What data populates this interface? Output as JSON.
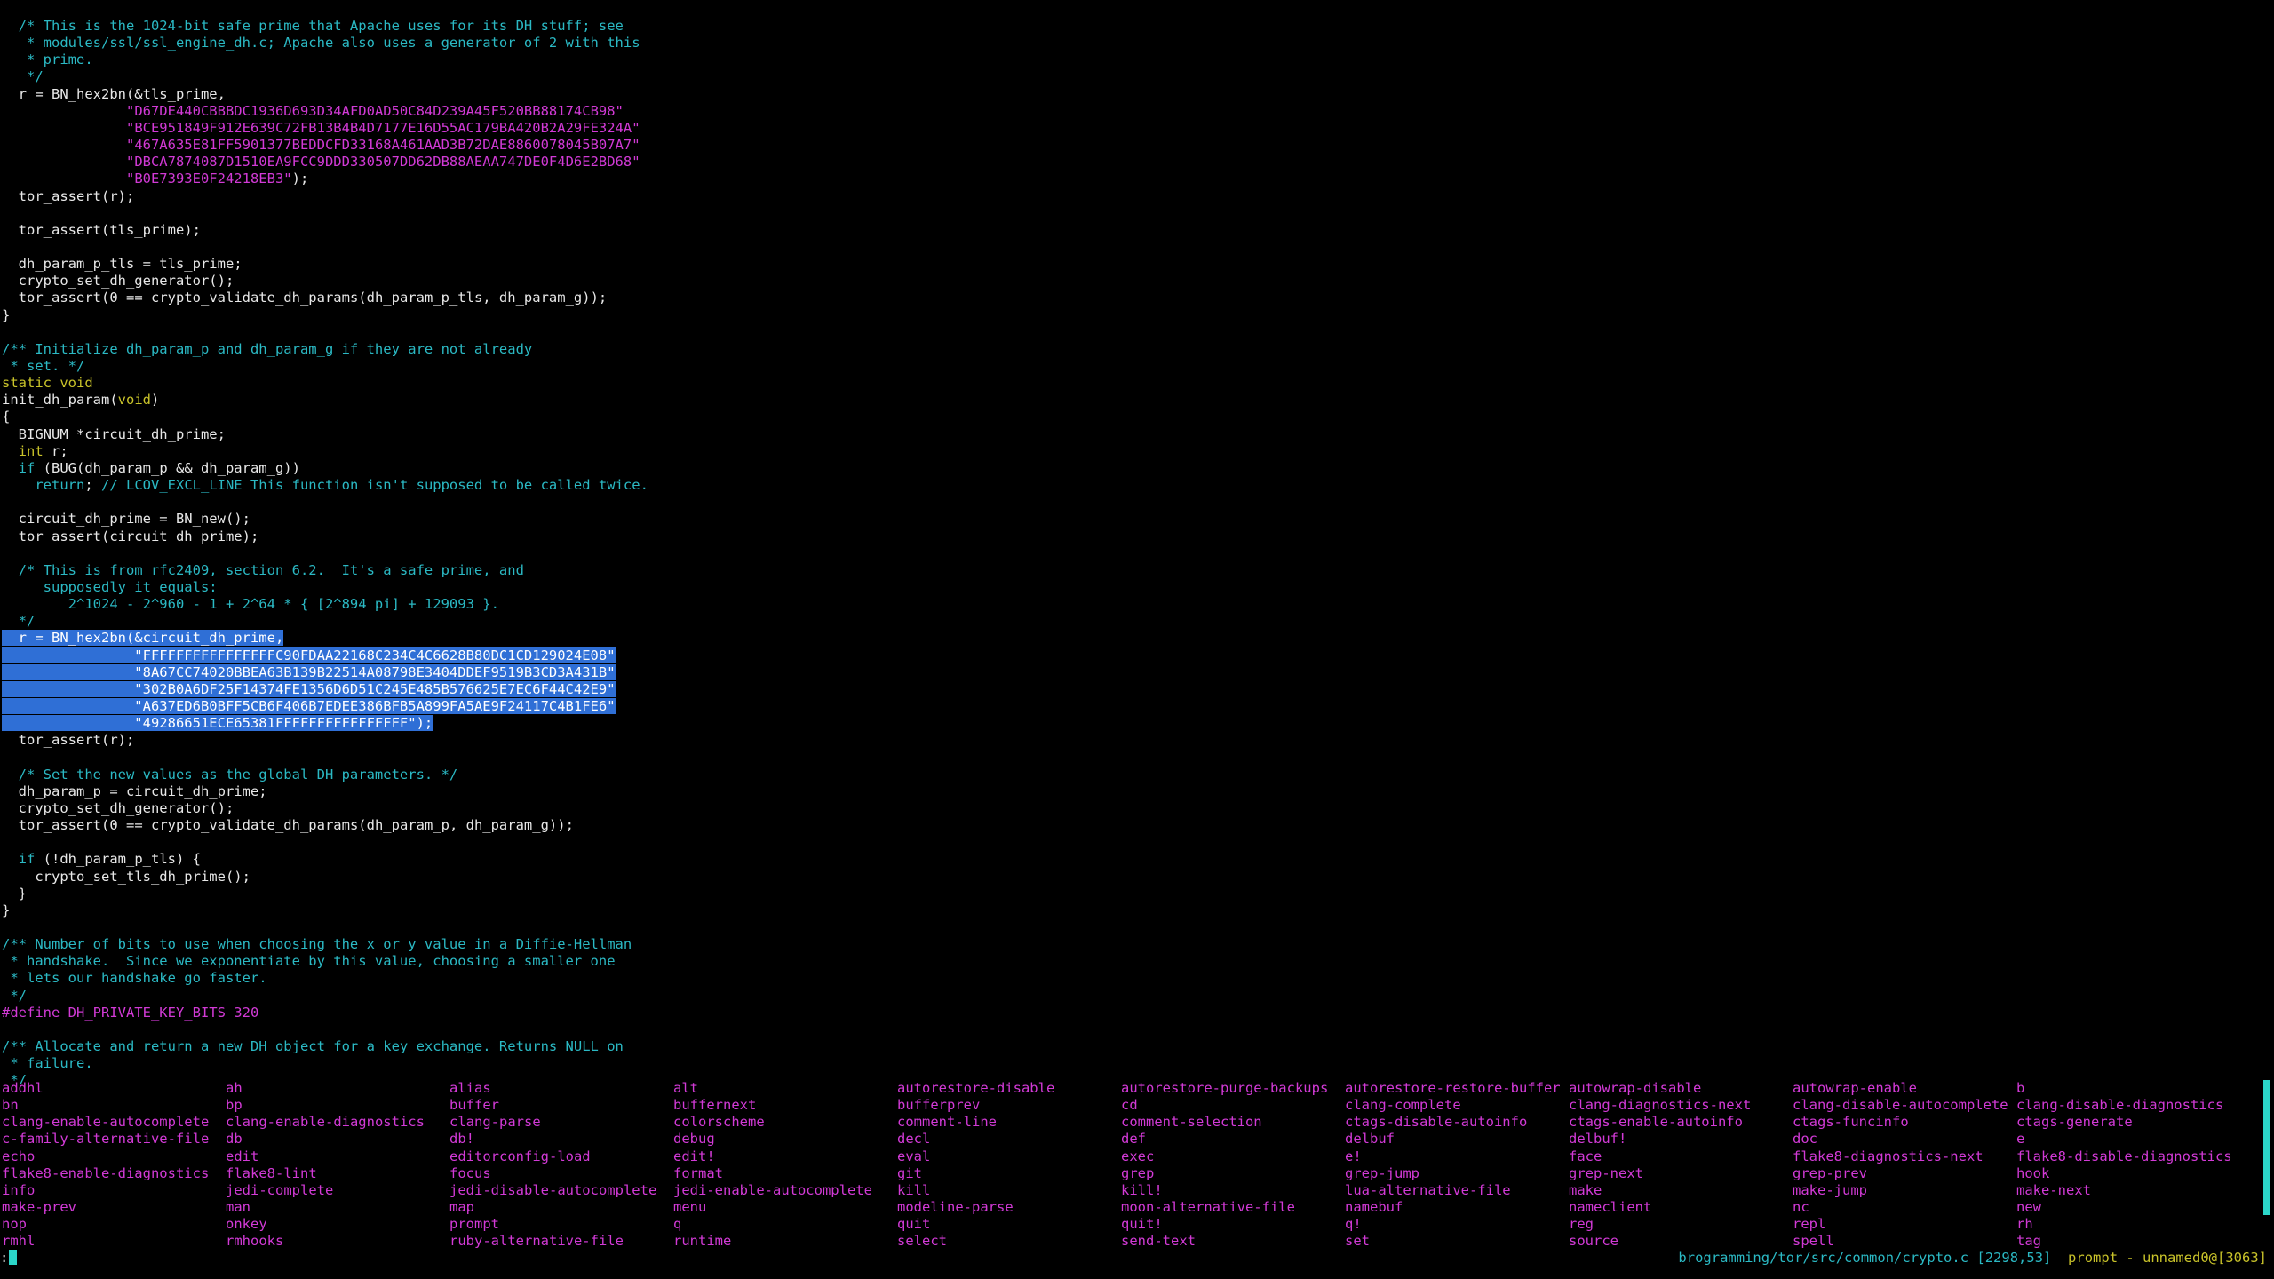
{
  "colors": {
    "background": "#000000",
    "comment": "#2bb9c4",
    "string": "#d23ad6",
    "type": "#c9c32a",
    "number": "#e01b1b",
    "selection": "#2f6fd6"
  },
  "code_lines": [
    [
      {
        "t": "  /* This is the 1024-bit safe prime that Apache uses for its DH stuff; see",
        "c": "comment"
      }
    ],
    [
      {
        "t": "   * modules/ssl/ssl_engine_dh.c; Apache also uses a generator of 2 with this",
        "c": "comment"
      }
    ],
    [
      {
        "t": "   * prime.",
        "c": "comment"
      }
    ],
    [
      {
        "t": "   */",
        "c": "comment"
      }
    ],
    [
      {
        "t": "  r = BN_hex2bn(&tls_prime,",
        "c": ""
      }
    ],
    [
      {
        "t": "               ",
        "c": ""
      },
      {
        "t": "\"D67DE440CBBBDC1936D693D34AFD0AD50C84D239A45F520BB88174CB98\"",
        "c": "string"
      }
    ],
    [
      {
        "t": "               ",
        "c": ""
      },
      {
        "t": "\"BCE951849F912E639C72FB13B4B4D7177E16D55AC179BA420B2A29FE324A\"",
        "c": "string"
      }
    ],
    [
      {
        "t": "               ",
        "c": ""
      },
      {
        "t": "\"467A635E81FF5901377BEDDCFD33168A461AAD3B72DAE8860078045B07A7\"",
        "c": "string"
      }
    ],
    [
      {
        "t": "               ",
        "c": ""
      },
      {
        "t": "\"DBCA7874087D1510EA9FCC9DDD330507DD62DB88AEAA747DE0F4D6E2BD68\"",
        "c": "string"
      }
    ],
    [
      {
        "t": "               ",
        "c": ""
      },
      {
        "t": "\"B0E7393E0F24218EB3\"",
        "c": "string"
      },
      {
        "t": ");",
        "c": ""
      }
    ],
    [
      {
        "t": "  tor_assert(r);",
        "c": ""
      }
    ],
    [
      {
        "t": "",
        "c": ""
      }
    ],
    [
      {
        "t": "  tor_assert(tls_prime);",
        "c": ""
      }
    ],
    [
      {
        "t": "",
        "c": ""
      }
    ],
    [
      {
        "t": "  dh_param_p_tls = tls_prime;",
        "c": ""
      }
    ],
    [
      {
        "t": "  crypto_set_dh_generator();",
        "c": ""
      }
    ],
    [
      {
        "t": "  tor_assert(",
        "c": ""
      },
      {
        "t": "0",
        "c": "number"
      },
      {
        "t": " == crypto_validate_dh_params(dh_param_p_tls, dh_param_g));",
        "c": ""
      }
    ],
    [
      {
        "t": "}",
        "c": ""
      }
    ],
    [
      {
        "t": "",
        "c": ""
      }
    ],
    [
      {
        "t": "/** Initialize dh_param_p and dh_param_g if they are not already",
        "c": "comment"
      }
    ],
    [
      {
        "t": " * set. */",
        "c": "comment"
      }
    ],
    [
      {
        "t": "static void",
        "c": "type"
      }
    ],
    [
      {
        "t": "init_dh_param(",
        "c": ""
      },
      {
        "t": "void",
        "c": "type"
      },
      {
        "t": ")",
        "c": ""
      }
    ],
    [
      {
        "t": "{",
        "c": ""
      }
    ],
    [
      {
        "t": "  BIGNUM *circuit_dh_prime;",
        "c": ""
      }
    ],
    [
      {
        "t": "  ",
        "c": ""
      },
      {
        "t": "int",
        "c": "type"
      },
      {
        "t": " r;",
        "c": ""
      }
    ],
    [
      {
        "t": "  ",
        "c": ""
      },
      {
        "t": "if",
        "c": "kw"
      },
      {
        "t": " (BUG(dh_param_p && dh_param_g))",
        "c": ""
      }
    ],
    [
      {
        "t": "    ",
        "c": ""
      },
      {
        "t": "return",
        "c": "kw"
      },
      {
        "t": "; ",
        "c": ""
      },
      {
        "t": "// LCOV_EXCL_LINE This function isn't supposed to be called twice.",
        "c": "comment"
      }
    ],
    [
      {
        "t": "",
        "c": ""
      }
    ],
    [
      {
        "t": "  circuit_dh_prime = BN_new();",
        "c": ""
      }
    ],
    [
      {
        "t": "  tor_assert(circuit_dh_prime);",
        "c": ""
      }
    ],
    [
      {
        "t": "",
        "c": ""
      }
    ],
    [
      {
        "t": "  /* This is from rfc2409, section 6.2.  It's a safe prime, and",
        "c": "comment"
      }
    ],
    [
      {
        "t": "     supposedly it equals:",
        "c": "comment"
      }
    ],
    [
      {
        "t": "        2^1024 - 2^960 - 1 + 2^64 * { [2^894 pi] + 129093 }.",
        "c": "comment"
      }
    ],
    [
      {
        "t": "  */",
        "c": "comment"
      }
    ],
    [
      {
        "t": "  r = BN_hex2bn(&circuit_dh_prime,",
        "c": "sel"
      }
    ],
    [
      {
        "t": "                \"FFFFFFFFFFFFFFFFC90FDAA22168C234C4C6628B80DC1CD129024E08\"",
        "c": "sel"
      }
    ],
    [
      {
        "t": "                \"8A67CC74020BBEA63B139B22514A08798E3404DDEF9519B3CD3A431B\"",
        "c": "sel"
      }
    ],
    [
      {
        "t": "                \"302B0A6DF25F14374FE1356D6D51C245E485B576625E7EC6F44C42E9\"",
        "c": "sel"
      }
    ],
    [
      {
        "t": "                \"A637ED6B0BFF5CB6F406B7EDEE386BFB5A899FA5AE9F24117C4B1FE6\"",
        "c": "sel"
      }
    ],
    [
      {
        "t": "                \"49286651ECE65381FFFFFFFFFFFFFFFF\");",
        "c": "sel"
      }
    ],
    [
      {
        "t": "  tor_assert(r);",
        "c": ""
      }
    ],
    [
      {
        "t": "",
        "c": ""
      }
    ],
    [
      {
        "t": "  /* Set the new values as the global DH parameters. */",
        "c": "comment"
      }
    ],
    [
      {
        "t": "  dh_param_p = circuit_dh_prime;",
        "c": ""
      }
    ],
    [
      {
        "t": "  crypto_set_dh_generator();",
        "c": ""
      }
    ],
    [
      {
        "t": "  tor_assert(",
        "c": ""
      },
      {
        "t": "0",
        "c": "number"
      },
      {
        "t": " == crypto_validate_dh_params(dh_param_p, dh_param_g));",
        "c": ""
      }
    ],
    [
      {
        "t": "",
        "c": ""
      }
    ],
    [
      {
        "t": "  ",
        "c": ""
      },
      {
        "t": "if",
        "c": "kw"
      },
      {
        "t": " (!dh_param_p_tls) {",
        "c": ""
      }
    ],
    [
      {
        "t": "    crypto_set_tls_dh_prime();",
        "c": ""
      }
    ],
    [
      {
        "t": "  }",
        "c": ""
      }
    ],
    [
      {
        "t": "}",
        "c": ""
      }
    ],
    [
      {
        "t": "",
        "c": ""
      }
    ],
    [
      {
        "t": "/** Number of bits to use when choosing the x or y value in a Diffie-Hellman",
        "c": "comment"
      }
    ],
    [
      {
        "t": " * handshake.  Since we exponentiate by this value, choosing a smaller one",
        "c": "comment"
      }
    ],
    [
      {
        "t": " * lets our handshake go faster.",
        "c": "comment"
      }
    ],
    [
      {
        "t": " */",
        "c": "comment"
      }
    ],
    [
      {
        "t": "#define DH_PRIVATE_KEY_BITS 320",
        "c": "pre"
      }
    ],
    [
      {
        "t": "",
        "c": ""
      }
    ],
    [
      {
        "t": "/** Allocate and return a new DH object for a key exchange. Returns NULL on",
        "c": "comment"
      }
    ],
    [
      {
        "t": " * failure.",
        "c": "comment"
      }
    ],
    [
      {
        "t": " */",
        "c": "comment"
      }
    ]
  ],
  "completion_columns": [
    [
      "addhl",
      "bn",
      "clang-enable-autocomplete",
      "c-family-alternative-file",
      "echo",
      "flake8-enable-diagnostics",
      "info",
      "make-prev",
      "nop",
      "rmhl"
    ],
    [
      "ah",
      "bp",
      "clang-enable-diagnostics",
      "db",
      "edit",
      "flake8-lint",
      "jedi-complete",
      "man",
      "onkey",
      "rmhooks"
    ],
    [
      "alias",
      "buffer",
      "clang-parse",
      "db!",
      "editorconfig-load",
      "focus",
      "jedi-disable-autocomplete",
      "map",
      "prompt",
      "ruby-alternative-file"
    ],
    [
      "alt",
      "buffernext",
      "colorscheme",
      "debug",
      "edit!",
      "format",
      "jedi-enable-autocomplete",
      "menu",
      "q",
      "runtime"
    ],
    [
      "autorestore-disable",
      "bufferprev",
      "comment-line",
      "decl",
      "eval",
      "git",
      "kill",
      "modeline-parse",
      "quit",
      "select"
    ],
    [
      "autorestore-purge-backups",
      "cd",
      "comment-selection",
      "def",
      "exec",
      "grep",
      "kill!",
      "moon-alternative-file",
      "quit!",
      "send-text"
    ],
    [
      "autorestore-restore-buffer",
      "clang-complete",
      "ctags-disable-autoinfo",
      "delbuf",
      "e!",
      "grep-jump",
      "lua-alternative-file",
      "namebuf",
      "q!",
      "set"
    ],
    [
      "autowrap-disable",
      "clang-diagnostics-next",
      "ctags-enable-autoinfo",
      "delbuf!",
      "face",
      "grep-next",
      "make",
      "nameclient",
      "reg",
      "source"
    ],
    [
      "autowrap-enable",
      "clang-disable-autocomplete",
      "ctags-funcinfo",
      "doc",
      "flake8-diagnostics-next",
      "grep-prev",
      "make-jump",
      "nc",
      "repl",
      "spell"
    ],
    [
      "b",
      "clang-disable-diagnostics",
      "ctags-generate",
      "e",
      "flake8-disable-diagnostics",
      "hook",
      "make-next",
      "new",
      "rh",
      "tag"
    ]
  ],
  "status": {
    "path": "brogramming/tor/src/common/crypto.c [2298,53]",
    "mode": "prompt - unnamed0@[3063]"
  },
  "cmdline": {
    "prompt": ":"
  }
}
